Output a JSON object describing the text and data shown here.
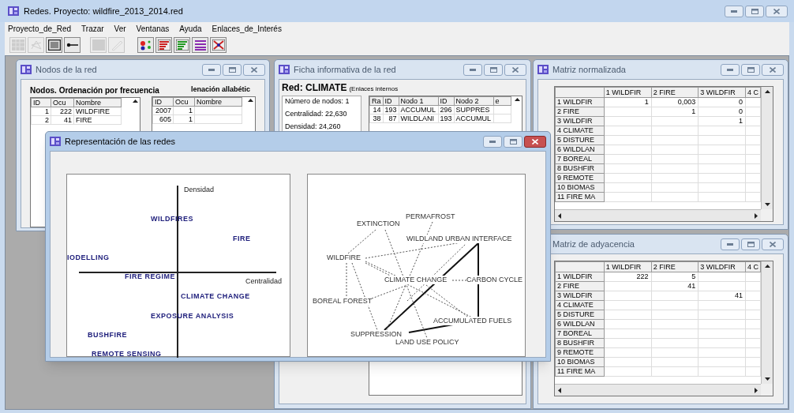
{
  "window": {
    "title": "Redes. Proyecto: wildfire_2013_2014.red"
  },
  "menu": [
    "Proyecto_de_Red",
    "Trazar",
    "Ver",
    "Ventanas",
    "Ayuda",
    "Enlaces_de_Interés"
  ],
  "toolbar": [
    {
      "kind": "grid",
      "disabled": true
    },
    {
      "kind": "network",
      "disabled": true
    },
    {
      "kind": "window",
      "disabled": false
    },
    {
      "kind": "connector",
      "disabled": false
    },
    {
      "kind": "square",
      "disabled": true
    },
    {
      "kind": "pen",
      "disabled": true
    },
    {
      "kind": "dots",
      "disabled": false
    },
    {
      "kind": "bars-red",
      "disabled": false
    },
    {
      "kind": "bars-green",
      "disabled": false
    },
    {
      "kind": "lines",
      "disabled": false
    },
    {
      "kind": "network-cross",
      "disabled": false
    }
  ],
  "nodes_window": {
    "title": "Nodos de la red",
    "active": false,
    "frequency_heading": "Nodos. Ordenación por frecuencia",
    "alphabetic_heading": "lenación allabétic",
    "frequency_table": {
      "columns": [
        "ID",
        "Ocu",
        "Nombre"
      ],
      "rows": [
        [
          "1",
          "222",
          "WILDFIRE"
        ],
        [
          "2",
          "41",
          "FIRE"
        ]
      ]
    },
    "alphabetic_table": {
      "columns": [
        "ID",
        "Ocu",
        "Nombre"
      ],
      "rows": [
        [
          "2007",
          "1"
        ],
        [
          "605",
          "1"
        ]
      ]
    }
  },
  "info_window": {
    "title": "Ficha informativa de la red",
    "active": false,
    "network_name": "Red: CLIMATE",
    "network_note": "(Enlaces internos",
    "stats": [
      "Número de nodos: 1",
      "Centralidad: 22,630",
      "Densidad: 24,260"
    ],
    "links_table": {
      "columns": [
        "Ra",
        "ID",
        "Nodo 1",
        "ID",
        "Nodo 2",
        "e"
      ],
      "rows": [
        [
          "14",
          "193",
          "ACCUMUL",
          "296",
          "SUPPRES"
        ],
        [
          "38",
          "87",
          "WILDLANI",
          "193",
          "ACCUMUL"
        ]
      ]
    }
  },
  "normalized_window": {
    "title": "Matriz normalizada",
    "active": false,
    "columns": [
      "1 WILDFIR",
      "2 FIRE",
      "3 WILDFIR",
      "4 C"
    ],
    "rows": [
      {
        "label": "1 WILDFIR",
        "cells": [
          {
            "kind": "value",
            "text": "1"
          },
          {
            "kind": "value",
            "text": "0,003"
          },
          {
            "kind": "value",
            "text": "0"
          }
        ]
      },
      {
        "label": "2 FIRE",
        "cells": [
          {
            "kind": "blank"
          },
          {
            "kind": "value",
            "text": "1"
          },
          {
            "kind": "value",
            "text": "0"
          }
        ]
      },
      {
        "label": "3 WILDFIR",
        "cells": [
          {
            "kind": "blank"
          },
          {
            "kind": "blank"
          },
          {
            "kind": "value",
            "text": "1"
          }
        ]
      },
      {
        "label": "4 CLIMATE"
      },
      {
        "label": "5 DISTURE"
      },
      {
        "label": "6 WILDLAN"
      },
      {
        "label": "7 BOREAL"
      },
      {
        "label": "8 BUSHFIR"
      },
      {
        "label": "9 REMOTE"
      },
      {
        "label": "10 BIOMAS"
      },
      {
        "label": "11 FIRE MA"
      }
    ]
  },
  "adjacency_window": {
    "title": "Matriz de adyacencia",
    "active": false,
    "columns": [
      "1 WILDFIR",
      "2 FIRE",
      "3 WILDFIR",
      "4 C"
    ],
    "rows": [
      {
        "label": "1 WILDFIR",
        "cells": [
          {
            "kind": "value",
            "text": "222"
          },
          {
            "kind": "value",
            "text": "5"
          }
        ]
      },
      {
        "label": "2 FIRE",
        "cells": [
          {
            "kind": "blank"
          },
          {
            "kind": "value",
            "text": "41"
          }
        ]
      },
      {
        "label": "3 WILDFIR",
        "cells": [
          {
            "kind": "blank"
          },
          {
            "kind": "blank"
          },
          {
            "kind": "value",
            "text": "41"
          }
        ]
      },
      {
        "label": "4 CLIMATE"
      },
      {
        "label": "5 DISTURE"
      },
      {
        "label": "6 WILDLAN"
      },
      {
        "label": "7 BOREAL"
      },
      {
        "label": "8 BUSHFIR"
      },
      {
        "label": "9 REMOTE"
      },
      {
        "label": "10 BIOMAS"
      },
      {
        "label": "11 FIRE MA"
      }
    ]
  },
  "representation_window": {
    "title": "Representación de las redes",
    "active": true,
    "strategic_diagram": {
      "y_axis_label": "Densidad",
      "x_axis_label": "Centralidad",
      "themes": [
        "WILDFIRES",
        "FIRE",
        "IODELLING",
        "FIRE REGIME",
        "CLIMATE CHANGE",
        "EXPOSURE ANALYSIS",
        "BUSHFIRE",
        "REMOTE SENSING"
      ]
    },
    "network": {
      "nodes": [
        "PERMAFROST",
        "EXTINCTION",
        "WILDLAND URBAN INTERFACE",
        "WILDFIRE",
        "CLIMATE CHANGE",
        "CARBON CYCLE",
        "BOREAL FOREST",
        "ACCUMULATED FUELS",
        "SUPPRESSION",
        "LAND USE POLICY"
      ]
    }
  }
}
